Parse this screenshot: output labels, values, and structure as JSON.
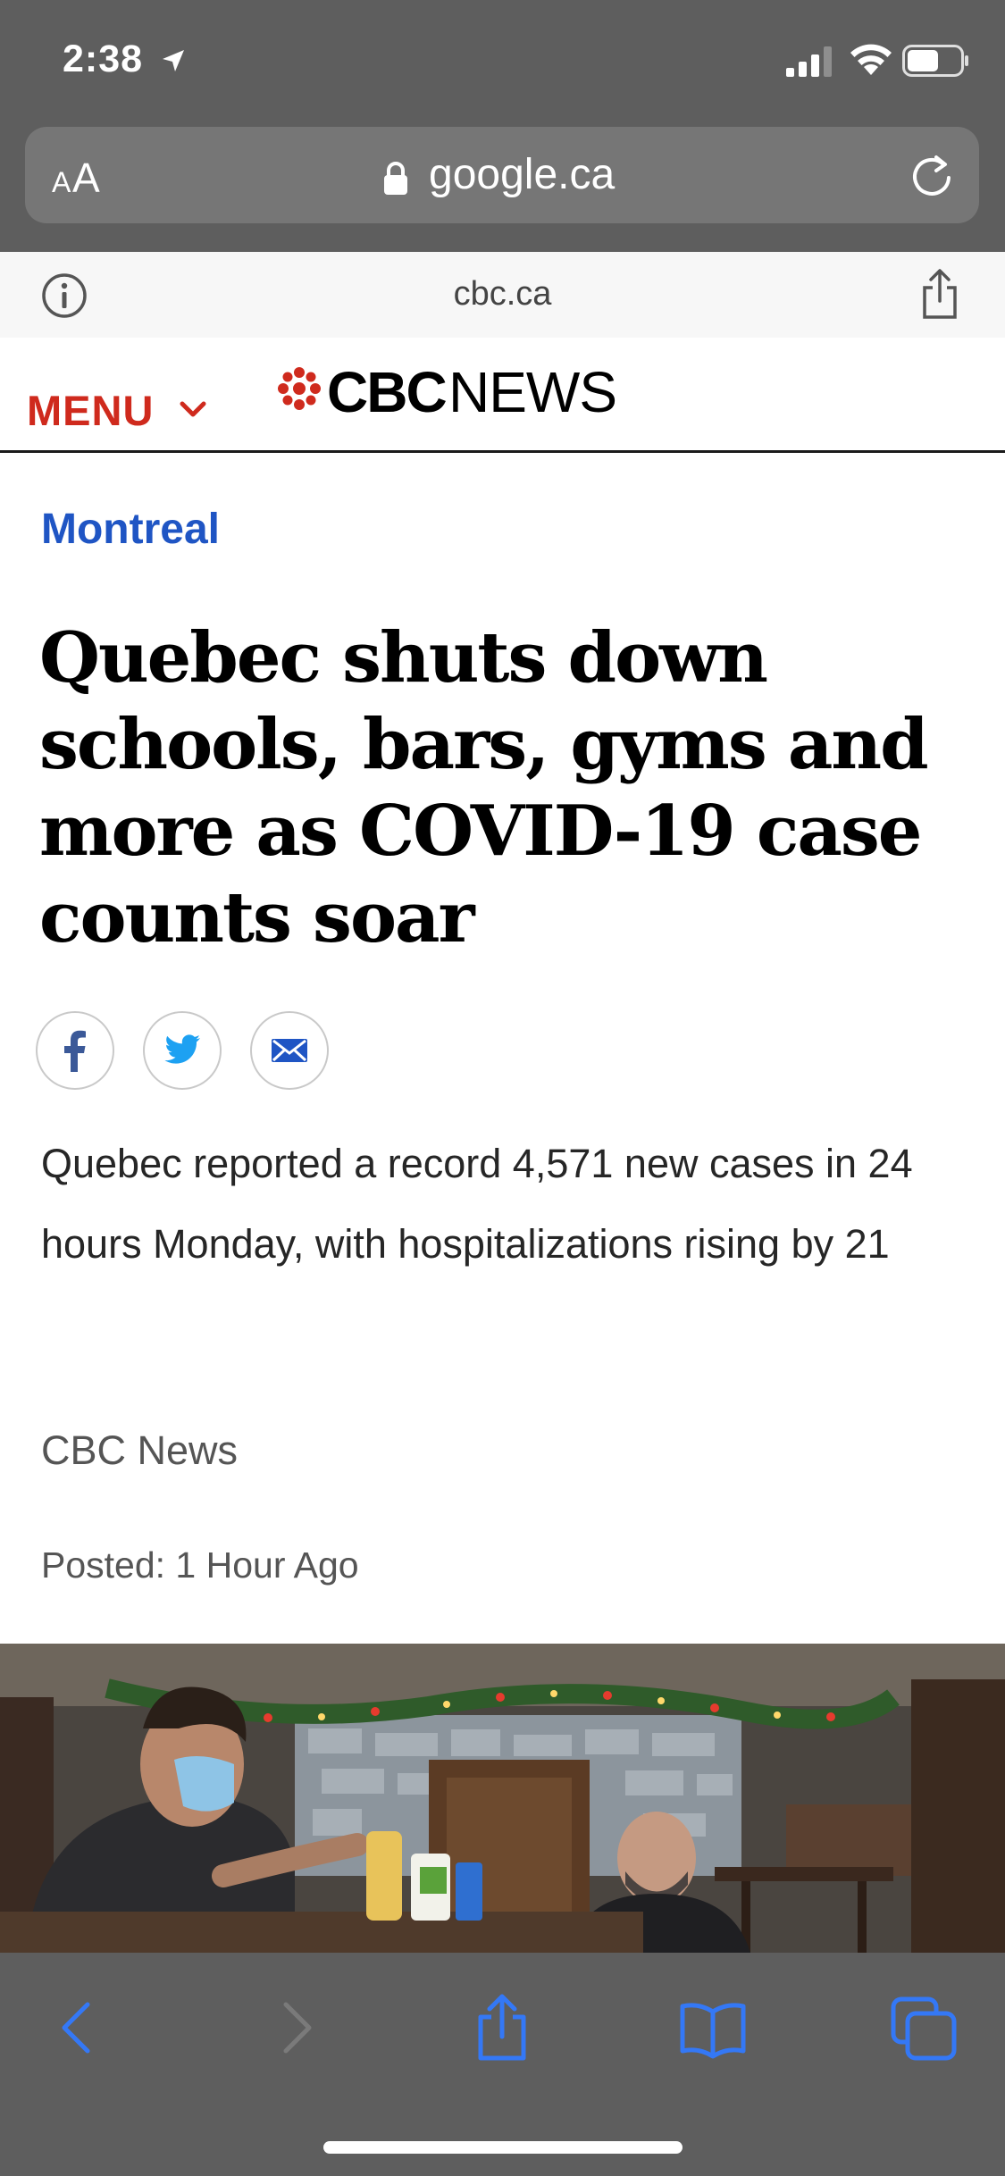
{
  "status": {
    "time": "2:38"
  },
  "browser": {
    "aa_small": "A",
    "aa_large": "A",
    "url": "google.ca",
    "site_domain": "cbc.ca"
  },
  "header": {
    "menu_label": "MENU",
    "logo_cbc": "CBC",
    "logo_news": "NEWS",
    "brand_color": "#cf2a1d"
  },
  "article": {
    "category": "Montreal",
    "headline": "Quebec shuts down schools, bars, gyms and more as COVID-19 case counts soar",
    "summary": "Quebec reported a record 4,571 new cases in 24 hours Monday, with hospitalizations rising by 21",
    "byline": "CBC News",
    "posted": "Posted: 1 Hour Ago"
  },
  "share_buttons": [
    {
      "name": "facebook",
      "icon": "facebook-icon",
      "color": "#3b5998"
    },
    {
      "name": "twitter",
      "icon": "twitter-icon",
      "color": "#1da1f2"
    },
    {
      "name": "email",
      "icon": "email-icon",
      "color": "#1f55c4"
    }
  ],
  "toolbar": {
    "icons": [
      "back-icon",
      "forward-icon",
      "share-icon",
      "bookmarks-icon",
      "tabs-icon"
    ],
    "accent_color": "#3478f6"
  }
}
